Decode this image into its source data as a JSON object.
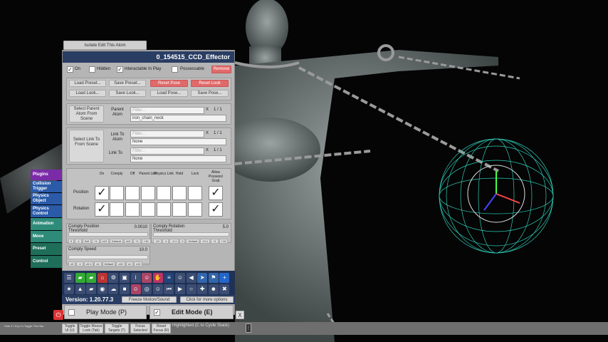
{
  "top_button": "Isolate Edit This Atom",
  "header": {
    "title": "0_154515_CCD_Effector"
  },
  "toggles": {
    "on": "On",
    "hidden": "Hidden",
    "interactable": "Interactable In Play",
    "possessable": "Possessable",
    "remove": "Remove"
  },
  "preset_buttons": [
    "Load Preset...",
    "Save Preset...",
    "Reset Pose",
    "Reset Look",
    "Load Look...",
    "Save Look...",
    "Load Pose...",
    "Save Pose..."
  ],
  "parent": {
    "select_label": "Select Parent Atom From Scene",
    "atom_label": "Parent Atom",
    "filter_placeholder": "Filter...",
    "count": "1 / 1",
    "value": "iron_chain_neck",
    "clear": "X"
  },
  "link": {
    "select_label": "Select Link To From Scene",
    "atom_label": "Link To Atom",
    "atom_value": "None",
    "link_label": "Link To",
    "link_value": "None",
    "filter_placeholder": "Filter...",
    "count": "1 / 1",
    "clear": "X"
  },
  "grid": {
    "columns": [
      "On",
      "Comply",
      "Off",
      "Parent Link",
      "Physics Link",
      "Hold",
      "Lock",
      "Allow Possess/ Grab"
    ],
    "rows": [
      {
        "label": "Position",
        "checked": [
          true,
          false,
          false,
          false,
          false,
          false,
          false,
          true
        ]
      },
      {
        "label": "Rotation",
        "checked": [
          true,
          false,
          false,
          false,
          false,
          false,
          false,
          true
        ]
      }
    ],
    "check": "✓"
  },
  "sliders": [
    {
      "label": "Comply Position Threshold",
      "value": "0.0010",
      "ticks": [
        "0",
        "-1",
        "Def",
        "+1",
        "x10",
        "Default",
        "x10",
        "+1",
        "+10"
      ]
    },
    {
      "label": "Comply Rotation Threshold",
      "value": "5.0",
      "ticks": [
        "-10",
        "-1",
        "-0.1",
        "0",
        "Default",
        "+0.1",
        "+1",
        "+10"
      ]
    },
    {
      "label": "Comply Speed",
      "value": "10.0",
      "ticks": [
        "x0",
        "-1",
        "x0.1",
        "x1",
        "Default",
        "x10",
        "x1",
        "x10"
      ]
    }
  ],
  "side_tabs": [
    {
      "label": "Plugins",
      "color": "#7b2ba8"
    },
    {
      "label": "Collision Trigger",
      "color": "#2a5aa8"
    },
    {
      "label": "Physics Object",
      "color": "#2a5aa8"
    },
    {
      "label": "Physics Control",
      "color": "#2a5aa8"
    },
    {
      "label": "Animation",
      "color": "#2e8b7a"
    },
    {
      "label": "Move",
      "color": "#2e8b7a"
    },
    {
      "label": "Preset",
      "color": "#1e6e5a"
    },
    {
      "label": "Control",
      "color": "#1e6e5a"
    }
  ],
  "toolbar": {
    "icons_row1": [
      "menu-icon",
      "folder-green-icon",
      "folder-open-icon",
      "home-icon",
      "gear-icon",
      "cube-icon",
      "info-icon",
      "person-icon",
      "hand-icon",
      "list-icon",
      "person-blue-icon",
      "speaker-icon",
      "share-icon",
      "flag-icon",
      "plus-icon"
    ],
    "icons_row2": [
      "star-icon",
      "folder-up-icon",
      "folder-icon",
      "camera-icon",
      "cloud-icon",
      "box-icon",
      "person-icon",
      "eye-icon",
      "person-settings-icon",
      "skip-back-icon",
      "play-icon",
      "circle-icon",
      "target-icon",
      "people-icon",
      "tools-icon"
    ]
  },
  "version": {
    "label": "Version: 1.20.77.3",
    "freeze": "Freeze Motion/Sound",
    "more": "Click for more options"
  },
  "modes": {
    "play": "Play Mode (P)",
    "edit": "Edit Mode (E)",
    "close": "X",
    "power": "⏻"
  },
  "bottom_bar": {
    "hide_label": "Hide if t Key To Toggle This Bar",
    "buttons": [
      "Toggle UI (U)",
      "Toggle Mouse Look (Tab)",
      "Toggle Targets (T)",
      "Focus Selected (F)",
      "Reset Focus (R)"
    ],
    "status": "Highlighted (C to Cycle Stack)",
    "menu": "⋮"
  },
  "colors": {
    "header": "#2a3d63",
    "panel": "#b5b5b5",
    "tabbar": "#1f3154",
    "sphere": "#2ecdb8"
  }
}
